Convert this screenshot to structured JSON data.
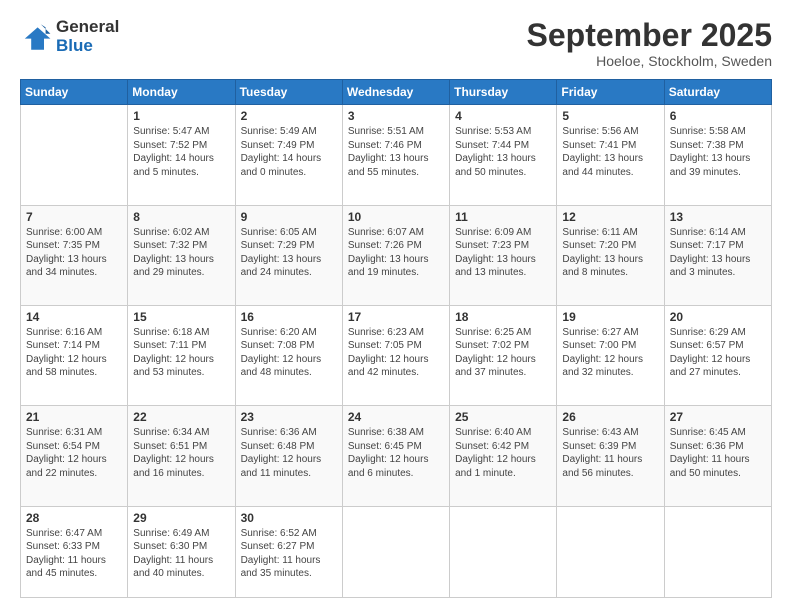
{
  "header": {
    "logo_general": "General",
    "logo_blue": "Blue",
    "month_title": "September 2025",
    "location": "Hoeloe, Stockholm, Sweden"
  },
  "days_of_week": [
    "Sunday",
    "Monday",
    "Tuesday",
    "Wednesday",
    "Thursday",
    "Friday",
    "Saturday"
  ],
  "weeks": [
    [
      {
        "day": "",
        "info": ""
      },
      {
        "day": "1",
        "info": "Sunrise: 5:47 AM\nSunset: 7:52 PM\nDaylight: 14 hours\nand 5 minutes."
      },
      {
        "day": "2",
        "info": "Sunrise: 5:49 AM\nSunset: 7:49 PM\nDaylight: 14 hours\nand 0 minutes."
      },
      {
        "day": "3",
        "info": "Sunrise: 5:51 AM\nSunset: 7:46 PM\nDaylight: 13 hours\nand 55 minutes."
      },
      {
        "day": "4",
        "info": "Sunrise: 5:53 AM\nSunset: 7:44 PM\nDaylight: 13 hours\nand 50 minutes."
      },
      {
        "day": "5",
        "info": "Sunrise: 5:56 AM\nSunset: 7:41 PM\nDaylight: 13 hours\nand 44 minutes."
      },
      {
        "day": "6",
        "info": "Sunrise: 5:58 AM\nSunset: 7:38 PM\nDaylight: 13 hours\nand 39 minutes."
      }
    ],
    [
      {
        "day": "7",
        "info": "Sunrise: 6:00 AM\nSunset: 7:35 PM\nDaylight: 13 hours\nand 34 minutes."
      },
      {
        "day": "8",
        "info": "Sunrise: 6:02 AM\nSunset: 7:32 PM\nDaylight: 13 hours\nand 29 minutes."
      },
      {
        "day": "9",
        "info": "Sunrise: 6:05 AM\nSunset: 7:29 PM\nDaylight: 13 hours\nand 24 minutes."
      },
      {
        "day": "10",
        "info": "Sunrise: 6:07 AM\nSunset: 7:26 PM\nDaylight: 13 hours\nand 19 minutes."
      },
      {
        "day": "11",
        "info": "Sunrise: 6:09 AM\nSunset: 7:23 PM\nDaylight: 13 hours\nand 13 minutes."
      },
      {
        "day": "12",
        "info": "Sunrise: 6:11 AM\nSunset: 7:20 PM\nDaylight: 13 hours\nand 8 minutes."
      },
      {
        "day": "13",
        "info": "Sunrise: 6:14 AM\nSunset: 7:17 PM\nDaylight: 13 hours\nand 3 minutes."
      }
    ],
    [
      {
        "day": "14",
        "info": "Sunrise: 6:16 AM\nSunset: 7:14 PM\nDaylight: 12 hours\nand 58 minutes."
      },
      {
        "day": "15",
        "info": "Sunrise: 6:18 AM\nSunset: 7:11 PM\nDaylight: 12 hours\nand 53 minutes."
      },
      {
        "day": "16",
        "info": "Sunrise: 6:20 AM\nSunset: 7:08 PM\nDaylight: 12 hours\nand 48 minutes."
      },
      {
        "day": "17",
        "info": "Sunrise: 6:23 AM\nSunset: 7:05 PM\nDaylight: 12 hours\nand 42 minutes."
      },
      {
        "day": "18",
        "info": "Sunrise: 6:25 AM\nSunset: 7:02 PM\nDaylight: 12 hours\nand 37 minutes."
      },
      {
        "day": "19",
        "info": "Sunrise: 6:27 AM\nSunset: 7:00 PM\nDaylight: 12 hours\nand 32 minutes."
      },
      {
        "day": "20",
        "info": "Sunrise: 6:29 AM\nSunset: 6:57 PM\nDaylight: 12 hours\nand 27 minutes."
      }
    ],
    [
      {
        "day": "21",
        "info": "Sunrise: 6:31 AM\nSunset: 6:54 PM\nDaylight: 12 hours\nand 22 minutes."
      },
      {
        "day": "22",
        "info": "Sunrise: 6:34 AM\nSunset: 6:51 PM\nDaylight: 12 hours\nand 16 minutes."
      },
      {
        "day": "23",
        "info": "Sunrise: 6:36 AM\nSunset: 6:48 PM\nDaylight: 12 hours\nand 11 minutes."
      },
      {
        "day": "24",
        "info": "Sunrise: 6:38 AM\nSunset: 6:45 PM\nDaylight: 12 hours\nand 6 minutes."
      },
      {
        "day": "25",
        "info": "Sunrise: 6:40 AM\nSunset: 6:42 PM\nDaylight: 12 hours\nand 1 minute."
      },
      {
        "day": "26",
        "info": "Sunrise: 6:43 AM\nSunset: 6:39 PM\nDaylight: 11 hours\nand 56 minutes."
      },
      {
        "day": "27",
        "info": "Sunrise: 6:45 AM\nSunset: 6:36 PM\nDaylight: 11 hours\nand 50 minutes."
      }
    ],
    [
      {
        "day": "28",
        "info": "Sunrise: 6:47 AM\nSunset: 6:33 PM\nDaylight: 11 hours\nand 45 minutes."
      },
      {
        "day": "29",
        "info": "Sunrise: 6:49 AM\nSunset: 6:30 PM\nDaylight: 11 hours\nand 40 minutes."
      },
      {
        "day": "30",
        "info": "Sunrise: 6:52 AM\nSunset: 6:27 PM\nDaylight: 11 hours\nand 35 minutes."
      },
      {
        "day": "",
        "info": ""
      },
      {
        "day": "",
        "info": ""
      },
      {
        "day": "",
        "info": ""
      },
      {
        "day": "",
        "info": ""
      }
    ]
  ]
}
